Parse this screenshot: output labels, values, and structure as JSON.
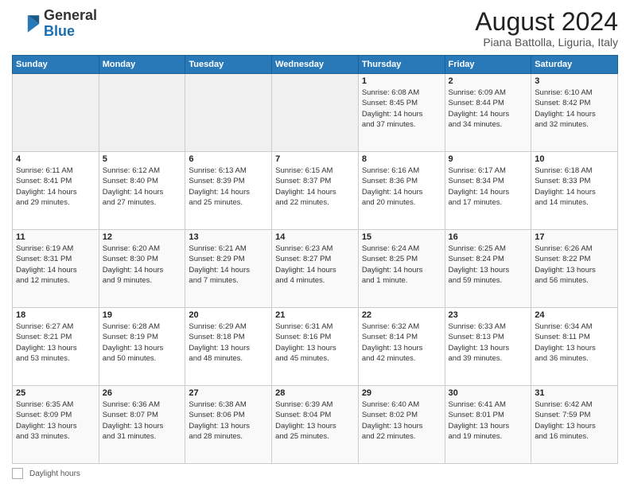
{
  "header": {
    "logo_general": "General",
    "logo_blue": "Blue",
    "title": "August 2024",
    "location": "Piana Battolla, Liguria, Italy"
  },
  "days_of_week": [
    "Sunday",
    "Monday",
    "Tuesday",
    "Wednesday",
    "Thursday",
    "Friday",
    "Saturday"
  ],
  "weeks": [
    [
      {
        "day": "",
        "info": ""
      },
      {
        "day": "",
        "info": ""
      },
      {
        "day": "",
        "info": ""
      },
      {
        "day": "",
        "info": ""
      },
      {
        "day": "1",
        "info": "Sunrise: 6:08 AM\nSunset: 8:45 PM\nDaylight: 14 hours\nand 37 minutes."
      },
      {
        "day": "2",
        "info": "Sunrise: 6:09 AM\nSunset: 8:44 PM\nDaylight: 14 hours\nand 34 minutes."
      },
      {
        "day": "3",
        "info": "Sunrise: 6:10 AM\nSunset: 8:42 PM\nDaylight: 14 hours\nand 32 minutes."
      }
    ],
    [
      {
        "day": "4",
        "info": "Sunrise: 6:11 AM\nSunset: 8:41 PM\nDaylight: 14 hours\nand 29 minutes."
      },
      {
        "day": "5",
        "info": "Sunrise: 6:12 AM\nSunset: 8:40 PM\nDaylight: 14 hours\nand 27 minutes."
      },
      {
        "day": "6",
        "info": "Sunrise: 6:13 AM\nSunset: 8:39 PM\nDaylight: 14 hours\nand 25 minutes."
      },
      {
        "day": "7",
        "info": "Sunrise: 6:15 AM\nSunset: 8:37 PM\nDaylight: 14 hours\nand 22 minutes."
      },
      {
        "day": "8",
        "info": "Sunrise: 6:16 AM\nSunset: 8:36 PM\nDaylight: 14 hours\nand 20 minutes."
      },
      {
        "day": "9",
        "info": "Sunrise: 6:17 AM\nSunset: 8:34 PM\nDaylight: 14 hours\nand 17 minutes."
      },
      {
        "day": "10",
        "info": "Sunrise: 6:18 AM\nSunset: 8:33 PM\nDaylight: 14 hours\nand 14 minutes."
      }
    ],
    [
      {
        "day": "11",
        "info": "Sunrise: 6:19 AM\nSunset: 8:31 PM\nDaylight: 14 hours\nand 12 minutes."
      },
      {
        "day": "12",
        "info": "Sunrise: 6:20 AM\nSunset: 8:30 PM\nDaylight: 14 hours\nand 9 minutes."
      },
      {
        "day": "13",
        "info": "Sunrise: 6:21 AM\nSunset: 8:29 PM\nDaylight: 14 hours\nand 7 minutes."
      },
      {
        "day": "14",
        "info": "Sunrise: 6:23 AM\nSunset: 8:27 PM\nDaylight: 14 hours\nand 4 minutes."
      },
      {
        "day": "15",
        "info": "Sunrise: 6:24 AM\nSunset: 8:25 PM\nDaylight: 14 hours\nand 1 minute."
      },
      {
        "day": "16",
        "info": "Sunrise: 6:25 AM\nSunset: 8:24 PM\nDaylight: 13 hours\nand 59 minutes."
      },
      {
        "day": "17",
        "info": "Sunrise: 6:26 AM\nSunset: 8:22 PM\nDaylight: 13 hours\nand 56 minutes."
      }
    ],
    [
      {
        "day": "18",
        "info": "Sunrise: 6:27 AM\nSunset: 8:21 PM\nDaylight: 13 hours\nand 53 minutes."
      },
      {
        "day": "19",
        "info": "Sunrise: 6:28 AM\nSunset: 8:19 PM\nDaylight: 13 hours\nand 50 minutes."
      },
      {
        "day": "20",
        "info": "Sunrise: 6:29 AM\nSunset: 8:18 PM\nDaylight: 13 hours\nand 48 minutes."
      },
      {
        "day": "21",
        "info": "Sunrise: 6:31 AM\nSunset: 8:16 PM\nDaylight: 13 hours\nand 45 minutes."
      },
      {
        "day": "22",
        "info": "Sunrise: 6:32 AM\nSunset: 8:14 PM\nDaylight: 13 hours\nand 42 minutes."
      },
      {
        "day": "23",
        "info": "Sunrise: 6:33 AM\nSunset: 8:13 PM\nDaylight: 13 hours\nand 39 minutes."
      },
      {
        "day": "24",
        "info": "Sunrise: 6:34 AM\nSunset: 8:11 PM\nDaylight: 13 hours\nand 36 minutes."
      }
    ],
    [
      {
        "day": "25",
        "info": "Sunrise: 6:35 AM\nSunset: 8:09 PM\nDaylight: 13 hours\nand 33 minutes."
      },
      {
        "day": "26",
        "info": "Sunrise: 6:36 AM\nSunset: 8:07 PM\nDaylight: 13 hours\nand 31 minutes."
      },
      {
        "day": "27",
        "info": "Sunrise: 6:38 AM\nSunset: 8:06 PM\nDaylight: 13 hours\nand 28 minutes."
      },
      {
        "day": "28",
        "info": "Sunrise: 6:39 AM\nSunset: 8:04 PM\nDaylight: 13 hours\nand 25 minutes."
      },
      {
        "day": "29",
        "info": "Sunrise: 6:40 AM\nSunset: 8:02 PM\nDaylight: 13 hours\nand 22 minutes."
      },
      {
        "day": "30",
        "info": "Sunrise: 6:41 AM\nSunset: 8:01 PM\nDaylight: 13 hours\nand 19 minutes."
      },
      {
        "day": "31",
        "info": "Sunrise: 6:42 AM\nSunset: 7:59 PM\nDaylight: 13 hours\nand 16 minutes."
      }
    ]
  ],
  "footer": {
    "daylight_label": "Daylight hours"
  }
}
